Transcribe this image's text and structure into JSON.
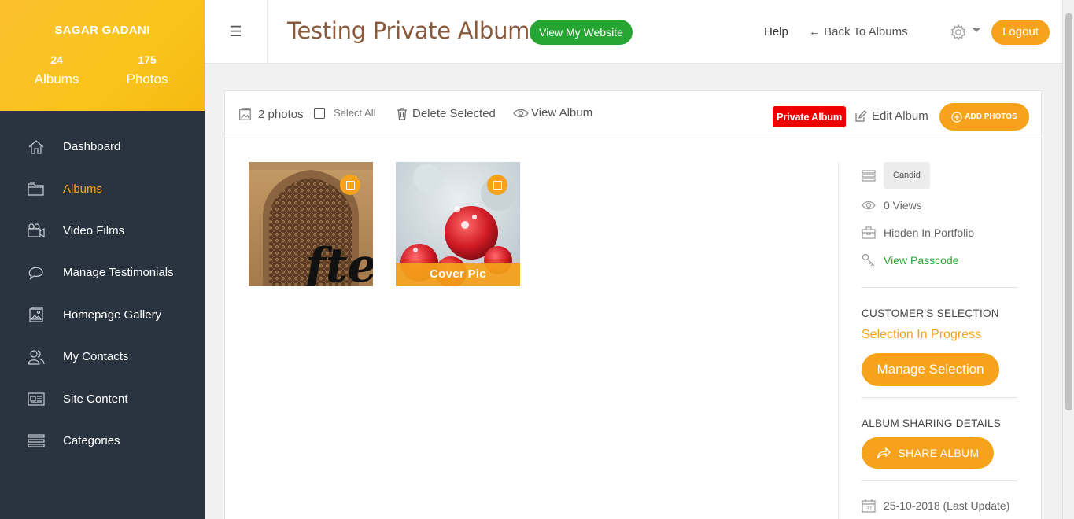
{
  "profile": {
    "name": "SAGAR GADANI",
    "albums_count": "24",
    "albums_label": "Albums",
    "photos_count": "175",
    "photos_label": "Photos"
  },
  "sidebar": {
    "items": [
      {
        "label": "Dashboard",
        "icon": "home-icon"
      },
      {
        "label": "Albums",
        "icon": "folder-icon",
        "active": true
      },
      {
        "label": "Video Films",
        "icon": "video-camera-icon"
      },
      {
        "label": "Manage Testimonials",
        "icon": "chat-icon"
      },
      {
        "label": "Homepage Gallery",
        "icon": "gallery-icon"
      },
      {
        "label": "My Contacts",
        "icon": "contacts-icon"
      },
      {
        "label": "Site Content",
        "icon": "content-icon"
      },
      {
        "label": "Categories",
        "icon": "list-icon"
      }
    ]
  },
  "header": {
    "title": "Testing Private Album",
    "view_website": "View My Website",
    "help": "Help",
    "back": "← Back To Albums",
    "logout": "Logout"
  },
  "toolbar": {
    "photos_count": "2 photos",
    "select_all": "Select All",
    "delete_selected": "Delete Selected",
    "view_album": "View Album",
    "private_badge": "Private Album",
    "edit_album": "Edit Album",
    "add_photos": "ADD PHOTOS"
  },
  "photos": [
    {
      "overlay": "fte"
    },
    {
      "label": "Cover Pic"
    }
  ],
  "info": {
    "category": "Candid",
    "views": "0 Views",
    "portfolio": "Hidden In Portfolio",
    "passcode": "View Passcode",
    "customer_selection_title": "CUSTOMER'S SELECTION",
    "selection_status": "Selection In Progress",
    "manage_selection": "Manage Selection",
    "sharing_title": "ALBUM SHARING DETAILS",
    "share_album": "SHARE ALBUM",
    "last_update": "25-10-2018 (Last Update)"
  },
  "colors": {
    "accent": "#f7a21b",
    "sidebar_bg": "#293440",
    "green": "#27a532",
    "private_red": "#ee0000",
    "title_brown": "#8b5a3c"
  }
}
